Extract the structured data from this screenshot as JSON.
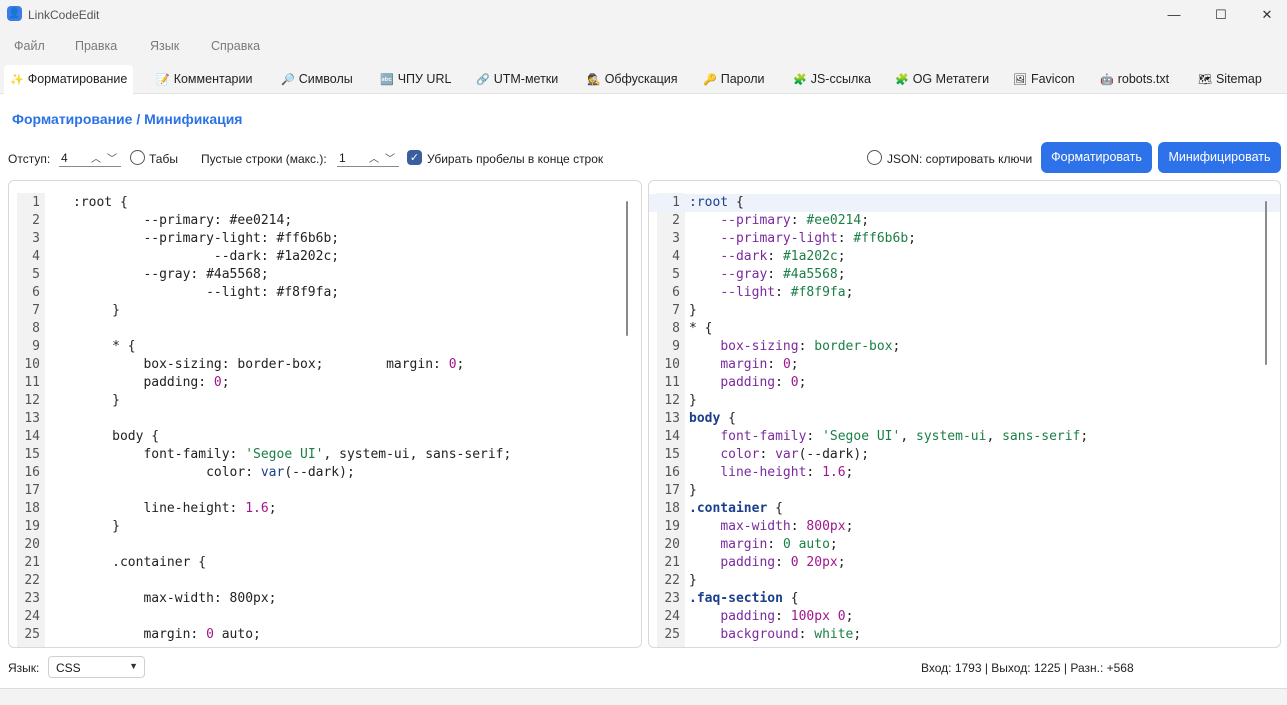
{
  "window": {
    "title": "LinkCodeEdit",
    "minimize": "—",
    "maximize": "☐",
    "close": "✕"
  },
  "menu": [
    "Файл",
    "Правка",
    "Язык",
    "Справка"
  ],
  "tabs": [
    {
      "icon": "✨",
      "label": "Форматирование",
      "icon_name": "sparkles-icon"
    },
    {
      "icon": "📝",
      "label": "Комментарии",
      "icon_name": "memo-icon"
    },
    {
      "icon": "🔎",
      "label": "Символы",
      "icon_name": "magnifier-icon"
    },
    {
      "icon": "🔤",
      "label": "ЧПУ URL",
      "icon_name": "abc-icon"
    },
    {
      "icon": "🔗",
      "label": "UTM-метки",
      "icon_name": "link-icon"
    },
    {
      "icon": "🕵",
      "label": "Обфускация",
      "icon_name": "detective-icon"
    },
    {
      "icon": "🔑",
      "label": "Пароли",
      "icon_name": "key-icon"
    },
    {
      "icon": "🧩",
      "label": "JS-ссылка",
      "icon_name": "puzzle-icon"
    },
    {
      "icon": "🧩",
      "label": "OG Метатеги",
      "icon_name": "puzzle-icon"
    },
    {
      "icon": "🖼",
      "label": "Favicon",
      "icon_name": "image-icon"
    },
    {
      "icon": "🤖",
      "label": "robots.txt",
      "icon_name": "robot-icon"
    },
    {
      "icon": "🗺",
      "label": "Sitemap",
      "icon_name": "map-icon"
    }
  ],
  "panel": {
    "heading": "Форматирование / Минификация",
    "indent_label": "Отступ:",
    "indent_value": "4",
    "tabs_label": "Табы",
    "tabs_checked": false,
    "empty_lines_label": "Пустые строки (макс.):",
    "empty_lines_value": "1",
    "trim_label": "Убирать пробелы в конце строк",
    "trim_checked": true,
    "json_sort_label": "JSON: сортировать ключи",
    "json_sort_checked": false,
    "format_button": "Форматировать",
    "minify_button": "Минифицировать"
  },
  "input_editor": [
    {
      "n": "1",
      "indent": "",
      "parts": [
        [
          ":root {",
          ""
        ]
      ]
    },
    {
      "n": "2",
      "indent": "         ",
      "parts": [
        [
          "--primary: #ee0214;",
          ""
        ]
      ]
    },
    {
      "n": "3",
      "indent": "         ",
      "parts": [
        [
          "--primary-light: #ff6b6b;",
          ""
        ]
      ]
    },
    {
      "n": "4",
      "indent": "                  ",
      "parts": [
        [
          "--dark: #1a202c;",
          ""
        ]
      ]
    },
    {
      "n": "5",
      "indent": "         ",
      "parts": [
        [
          "--gray: #4a5568;",
          ""
        ]
      ]
    },
    {
      "n": "6",
      "indent": "                 ",
      "parts": [
        [
          "--light: #f8f9fa;",
          ""
        ]
      ]
    },
    {
      "n": "7",
      "indent": "     ",
      "parts": [
        [
          "}",
          ""
        ]
      ]
    },
    {
      "n": "8",
      "indent": "",
      "parts": []
    },
    {
      "n": "9",
      "indent": "     ",
      "parts": [
        [
          "* {",
          ""
        ]
      ]
    },
    {
      "n": "10",
      "indent": "         ",
      "parts": [
        [
          "box-sizing: border-box;",
          ""
        ],
        [
          "        margin: ",
          ""
        ],
        [
          "0",
          "c-num"
        ],
        [
          ";",
          ""
        ]
      ]
    },
    {
      "n": "11",
      "indent": "         ",
      "parts": [
        [
          "padding: ",
          ""
        ],
        [
          "0",
          "c-num"
        ],
        [
          ";",
          ""
        ]
      ]
    },
    {
      "n": "12",
      "indent": "     ",
      "parts": [
        [
          "}",
          ""
        ]
      ]
    },
    {
      "n": "13",
      "indent": "",
      "parts": []
    },
    {
      "n": "14",
      "indent": "     ",
      "parts": [
        [
          "body {",
          ""
        ]
      ]
    },
    {
      "n": "15",
      "indent": "         ",
      "parts": [
        [
          "font-family: ",
          ""
        ],
        [
          "'Segoe UI'",
          "c-str"
        ],
        [
          ", system-ui, sans-serif;",
          ""
        ]
      ]
    },
    {
      "n": "16",
      "indent": "                 ",
      "parts": [
        [
          "color: ",
          ""
        ],
        [
          "var",
          "c-fn"
        ],
        [
          "(--dark);",
          ""
        ]
      ]
    },
    {
      "n": "17",
      "indent": "",
      "parts": []
    },
    {
      "n": "18",
      "indent": "         ",
      "parts": [
        [
          "line-height: ",
          ""
        ],
        [
          "1.6",
          "c-num"
        ],
        [
          ";",
          ""
        ]
      ]
    },
    {
      "n": "19",
      "indent": "     ",
      "parts": [
        [
          "}",
          ""
        ]
      ]
    },
    {
      "n": "20",
      "indent": "",
      "parts": []
    },
    {
      "n": "21",
      "indent": "     ",
      "parts": [
        [
          ".container {",
          ""
        ]
      ]
    },
    {
      "n": "22",
      "indent": "",
      "parts": []
    },
    {
      "n": "23",
      "indent": "         ",
      "parts": [
        [
          "max-width: 800px;",
          ""
        ]
      ]
    },
    {
      "n": "24",
      "indent": "",
      "parts": []
    },
    {
      "n": "25",
      "indent": "         ",
      "parts": [
        [
          "margin: ",
          ""
        ],
        [
          "0",
          "c-num"
        ],
        [
          " auto;",
          ""
        ]
      ]
    }
  ],
  "output_editor": [
    {
      "n": "1",
      "indent": "",
      "parts": [
        [
          ":root",
          "c-root"
        ],
        [
          " {",
          ""
        ]
      ]
    },
    {
      "n": "2",
      "indent": "    ",
      "parts": [
        [
          "--primary",
          "c-prop"
        ],
        [
          ": ",
          ""
        ],
        [
          "#ee0214",
          "c-val"
        ],
        [
          ";",
          ""
        ]
      ]
    },
    {
      "n": "3",
      "indent": "    ",
      "parts": [
        [
          "--primary-light",
          "c-prop"
        ],
        [
          ": ",
          ""
        ],
        [
          "#ff6b6b",
          "c-val"
        ],
        [
          ";",
          ""
        ]
      ]
    },
    {
      "n": "4",
      "indent": "    ",
      "parts": [
        [
          "--dark",
          "c-prop"
        ],
        [
          ": ",
          ""
        ],
        [
          "#1a202c",
          "c-val"
        ],
        [
          ";",
          ""
        ]
      ]
    },
    {
      "n": "5",
      "indent": "    ",
      "parts": [
        [
          "--gray",
          "c-prop"
        ],
        [
          ": ",
          ""
        ],
        [
          "#4a5568",
          "c-val"
        ],
        [
          ";",
          ""
        ]
      ]
    },
    {
      "n": "6",
      "indent": "    ",
      "parts": [
        [
          "--light",
          "c-prop"
        ],
        [
          ": ",
          ""
        ],
        [
          "#f8f9fa",
          "c-val"
        ],
        [
          ";",
          ""
        ]
      ]
    },
    {
      "n": "7",
      "indent": "",
      "parts": [
        [
          "}",
          ""
        ]
      ]
    },
    {
      "n": "8",
      "indent": "",
      "parts": [
        [
          "* {",
          ""
        ]
      ]
    },
    {
      "n": "9",
      "indent": "    ",
      "parts": [
        [
          "box-sizing",
          "c-prop"
        ],
        [
          ": ",
          ""
        ],
        [
          "border-box",
          "c-val"
        ],
        [
          ";",
          ""
        ]
      ]
    },
    {
      "n": "10",
      "indent": "    ",
      "parts": [
        [
          "margin",
          "c-prop"
        ],
        [
          ": ",
          ""
        ],
        [
          "0",
          "c-num"
        ],
        [
          ";",
          ""
        ]
      ]
    },
    {
      "n": "11",
      "indent": "    ",
      "parts": [
        [
          "padding",
          "c-prop"
        ],
        [
          ": ",
          ""
        ],
        [
          "0",
          "c-num"
        ],
        [
          ";",
          ""
        ]
      ]
    },
    {
      "n": "12",
      "indent": "",
      "parts": [
        [
          "}",
          ""
        ]
      ]
    },
    {
      "n": "13",
      "indent": "",
      "parts": [
        [
          "body",
          "c-sel"
        ],
        [
          " {",
          ""
        ]
      ]
    },
    {
      "n": "14",
      "indent": "    ",
      "parts": [
        [
          "font-family",
          "c-prop"
        ],
        [
          ": ",
          ""
        ],
        [
          "'Segoe UI'",
          "c-str"
        ],
        [
          ", ",
          ""
        ],
        [
          "system-ui",
          "c-val"
        ],
        [
          ", ",
          ""
        ],
        [
          "sans-serif",
          "c-val"
        ],
        [
          ";",
          ""
        ]
      ]
    },
    {
      "n": "15",
      "indent": "    ",
      "parts": [
        [
          "color",
          "c-prop"
        ],
        [
          ": ",
          ""
        ],
        [
          "var",
          "c-prop"
        ],
        [
          "(--dark);",
          ""
        ]
      ]
    },
    {
      "n": "16",
      "indent": "    ",
      "parts": [
        [
          "line-height",
          "c-prop"
        ],
        [
          ": ",
          ""
        ],
        [
          "1.6",
          "c-num"
        ],
        [
          ";",
          ""
        ]
      ]
    },
    {
      "n": "17",
      "indent": "",
      "parts": [
        [
          "}",
          ""
        ]
      ]
    },
    {
      "n": "18",
      "indent": "",
      "parts": [
        [
          ".container",
          "c-sel"
        ],
        [
          " {",
          ""
        ]
      ]
    },
    {
      "n": "19",
      "indent": "    ",
      "parts": [
        [
          "max-width",
          "c-prop"
        ],
        [
          ": ",
          ""
        ],
        [
          "800px",
          "c-num"
        ],
        [
          ";",
          ""
        ]
      ]
    },
    {
      "n": "20",
      "indent": "    ",
      "parts": [
        [
          "margin",
          "c-prop"
        ],
        [
          ": ",
          ""
        ],
        [
          "0 auto",
          "c-val"
        ],
        [
          ";",
          ""
        ]
      ]
    },
    {
      "n": "21",
      "indent": "    ",
      "parts": [
        [
          "padding",
          "c-prop"
        ],
        [
          ": ",
          ""
        ],
        [
          "0 20px",
          "c-num"
        ],
        [
          ";",
          ""
        ]
      ]
    },
    {
      "n": "22",
      "indent": "",
      "parts": [
        [
          "}",
          ""
        ]
      ]
    },
    {
      "n": "23",
      "indent": "",
      "parts": [
        [
          ".faq-section",
          "c-sel"
        ],
        [
          " {",
          ""
        ]
      ]
    },
    {
      "n": "24",
      "indent": "    ",
      "parts": [
        [
          "padding",
          "c-prop"
        ],
        [
          ": ",
          ""
        ],
        [
          "100px 0",
          "c-num"
        ],
        [
          ";",
          ""
        ]
      ]
    },
    {
      "n": "25",
      "indent": "    ",
      "parts": [
        [
          "background",
          "c-prop"
        ],
        [
          ": ",
          ""
        ],
        [
          "white",
          "c-val"
        ],
        [
          ";",
          ""
        ]
      ]
    }
  ],
  "status": {
    "language_label": "Язык:",
    "language_value": "CSS",
    "stats": "Вход: 1793 | Выход: 1225 | Разн.: +568"
  }
}
